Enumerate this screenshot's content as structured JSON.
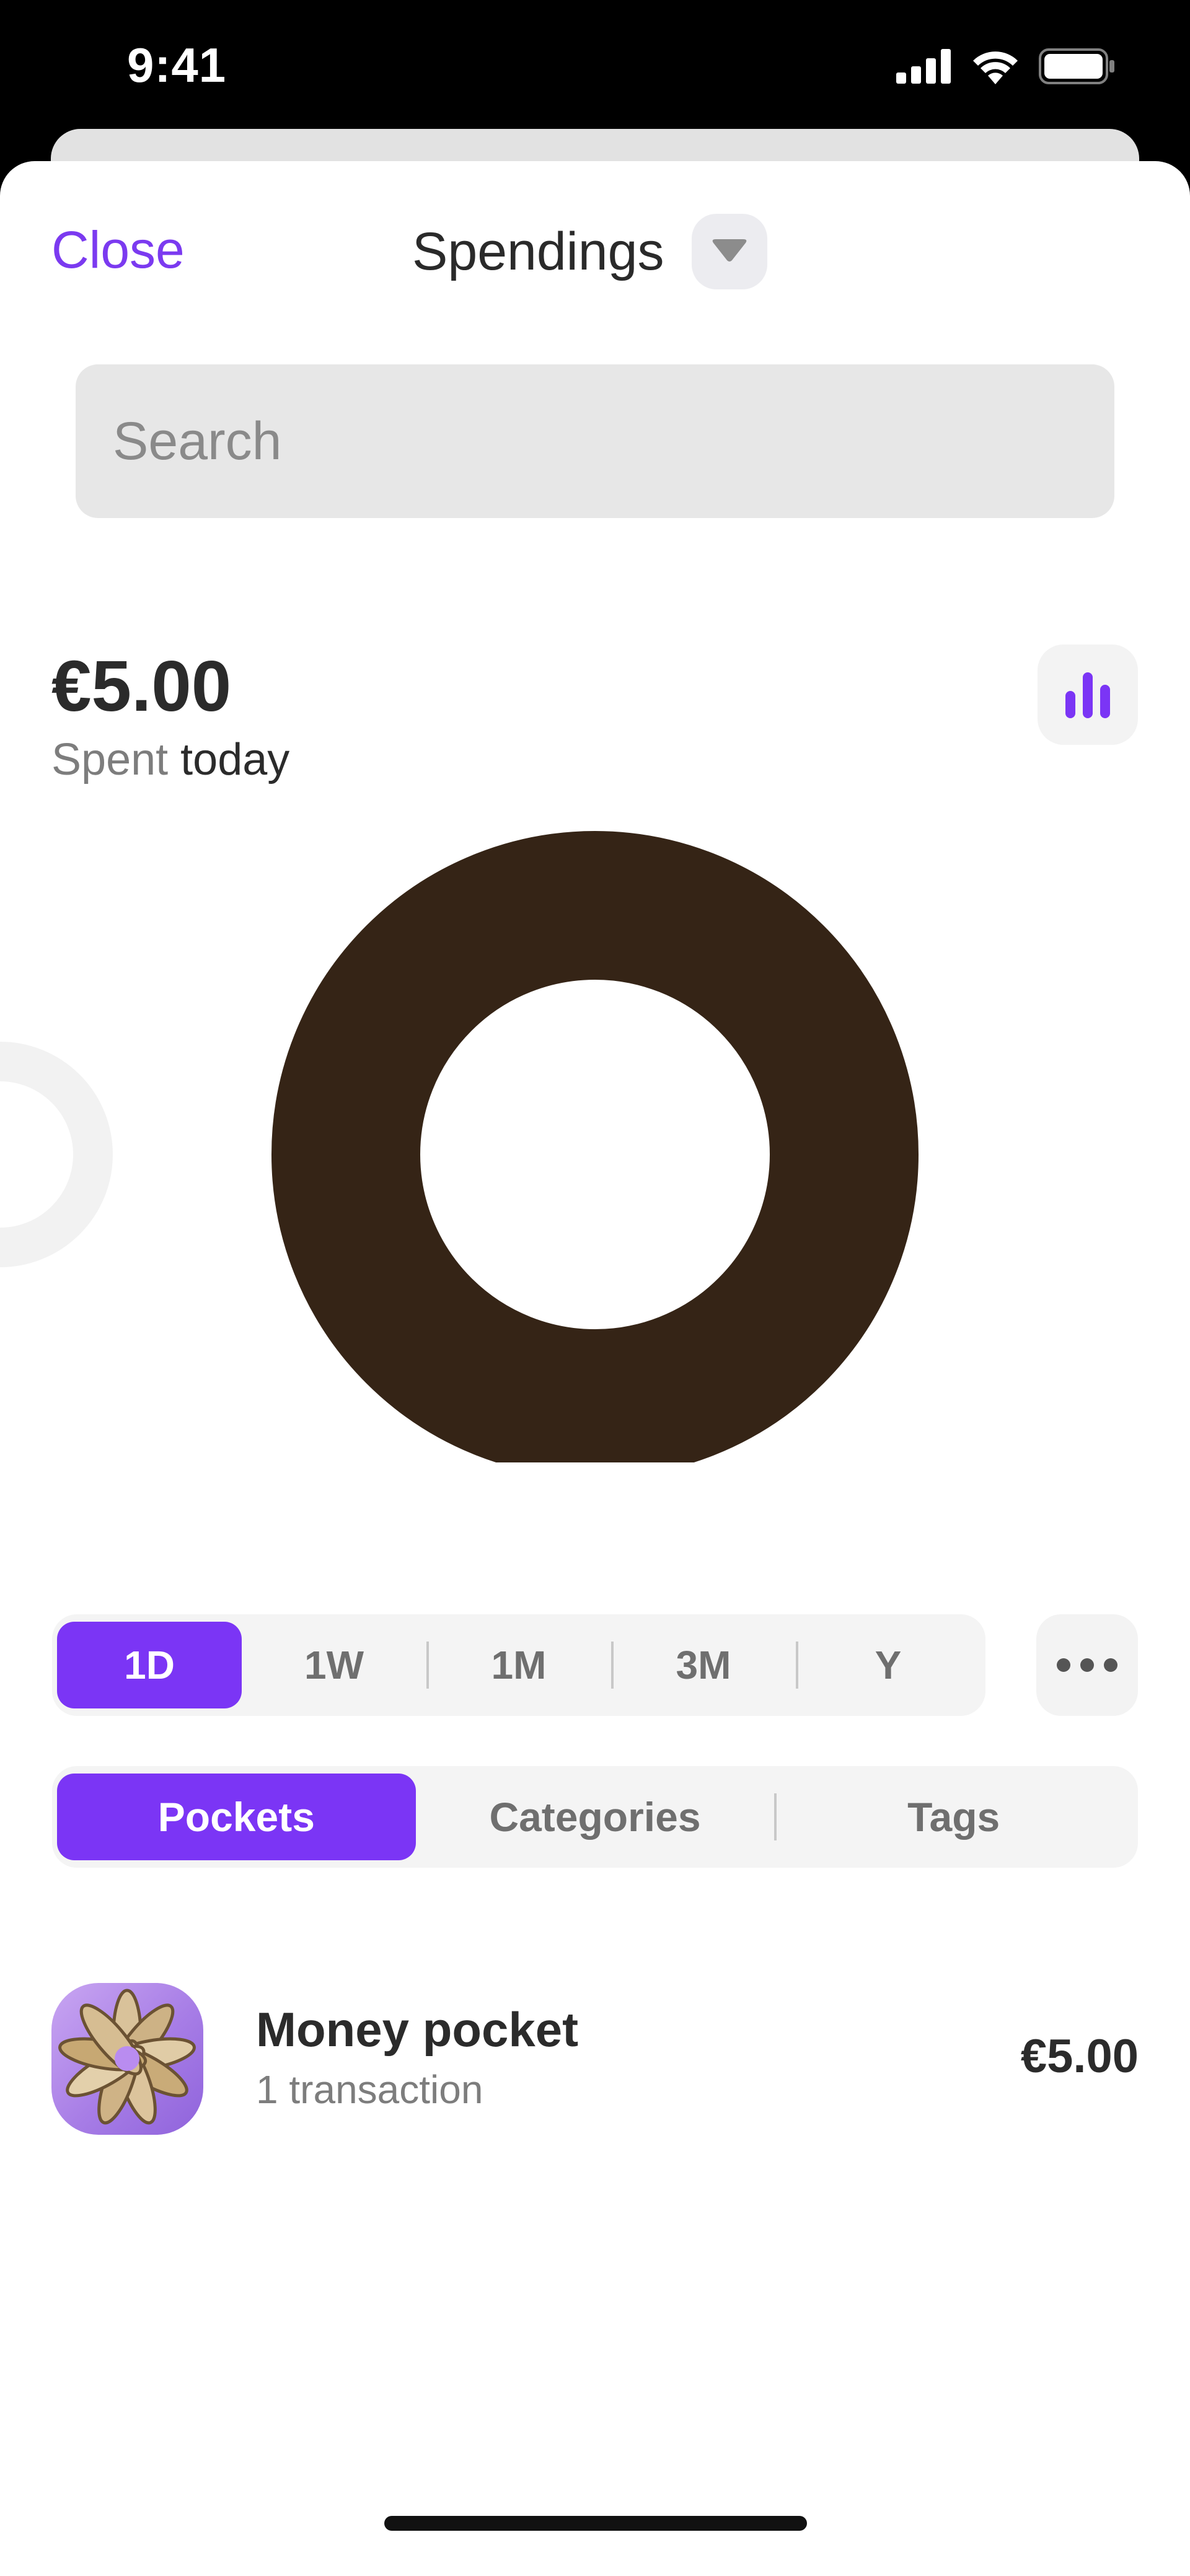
{
  "status_bar": {
    "time": "9:41",
    "icons": [
      "cellular-signal-icon",
      "wifi-icon",
      "battery-icon"
    ]
  },
  "header": {
    "close_label": "Close",
    "title": "Spendings",
    "dropdown_icon": "chevron-down-icon"
  },
  "search": {
    "placeholder": "Search"
  },
  "summary": {
    "amount": "€5.00",
    "label_muted": "Spent",
    "label_strong": "today",
    "chart_toggle_icon": "bar-chart-icon"
  },
  "chart_data": {
    "type": "pie",
    "slices": [
      {
        "label": "Money pocket",
        "value": 5.0,
        "color": "#352416"
      }
    ],
    "donut": true
  },
  "period_tabs": [
    {
      "label": "1D",
      "active": true
    },
    {
      "label": "1W",
      "active": false
    },
    {
      "label": "1M",
      "active": false
    },
    {
      "label": "3M",
      "active": false
    },
    {
      "label": "Y",
      "active": false
    }
  ],
  "more_icon": "more-horizontal-icon",
  "group_tabs": [
    {
      "label": "Pockets",
      "active": true
    },
    {
      "label": "Categories",
      "active": false
    },
    {
      "label": "Tags",
      "active": false
    }
  ],
  "pockets": [
    {
      "name": "Money pocket",
      "subtitle": "1 transaction",
      "amount": "€5.00",
      "icon": "pocket-emblem-icon"
    }
  ],
  "colors": {
    "accent": "#7b35f5",
    "donut": "#352416",
    "text": "#2b2b2b",
    "muted": "#7d7d7d"
  }
}
